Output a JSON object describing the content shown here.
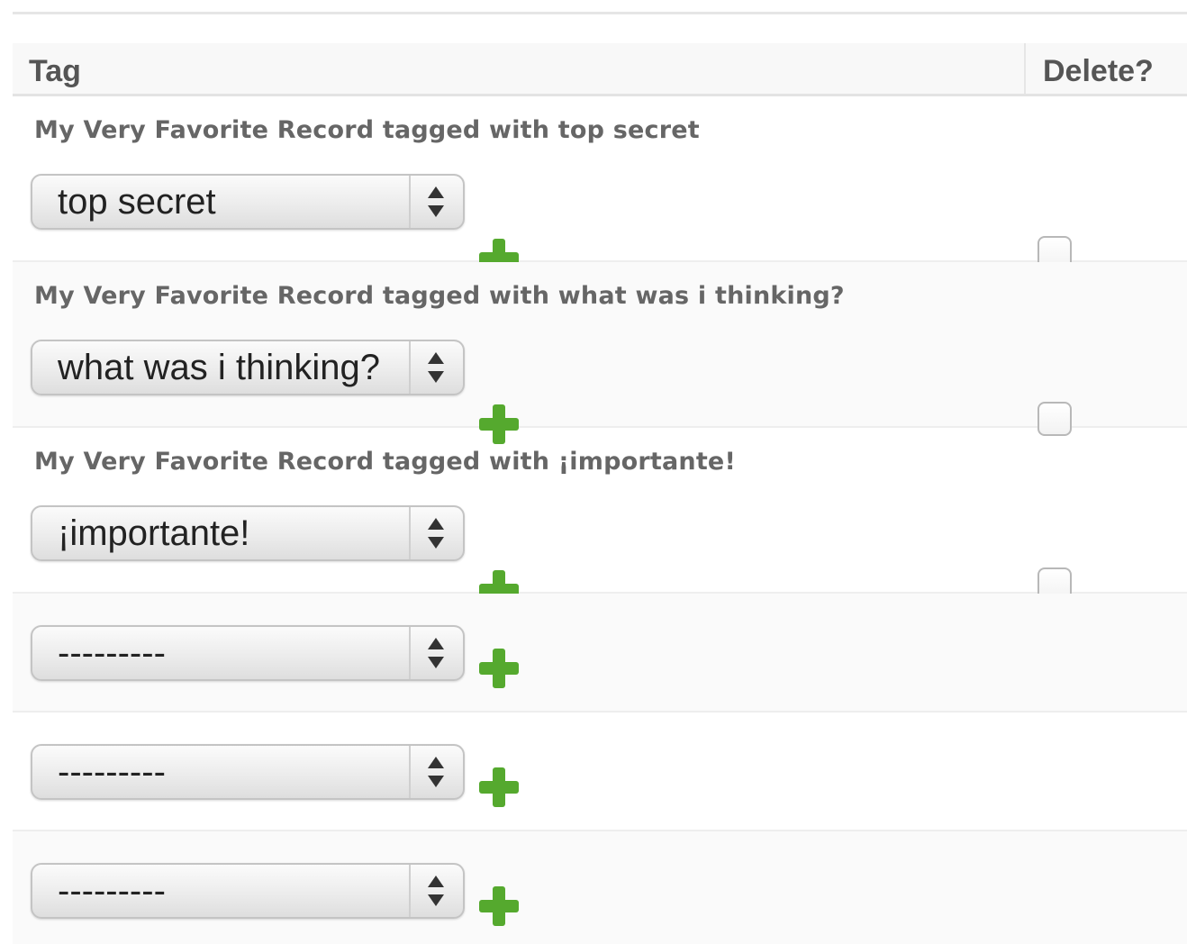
{
  "table": {
    "headers": {
      "tag": "Tag",
      "delete": "Delete?"
    },
    "rows": [
      {
        "label": "My Very Favorite Record tagged with top secret",
        "selected": "top secret",
        "delete_checked": false
      },
      {
        "label": "My Very Favorite Record tagged with what was i thinking?",
        "selected": "what was i thinking?",
        "delete_checked": false
      },
      {
        "label": "My Very Favorite Record tagged with ¡importante!",
        "selected": "¡importante!",
        "delete_checked": false
      },
      {
        "selected": "---------"
      },
      {
        "selected": "---------"
      },
      {
        "selected": "---------"
      }
    ]
  },
  "colors": {
    "add_icon": "#55a92e",
    "header_text": "#555555",
    "label_text": "#666666"
  },
  "icons": {
    "add": "plus-icon",
    "select_arrows": "updown-arrows-icon"
  }
}
